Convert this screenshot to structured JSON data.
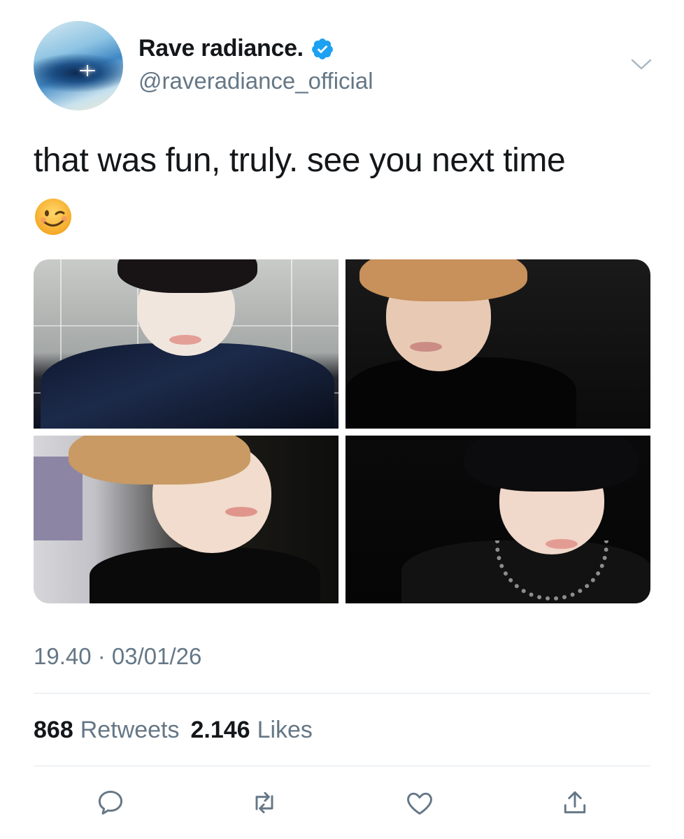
{
  "tweet": {
    "author": {
      "display_name": "Rave radiance.",
      "handle": "@raveradiance_official",
      "verified": true,
      "verified_color": "#1da1f2"
    },
    "text": "that was fun, truly. see you next time",
    "emoji": "winking-face",
    "media": [
      {
        "name": "photo-1"
      },
      {
        "name": "photo-2"
      },
      {
        "name": "photo-3"
      },
      {
        "name": "photo-4"
      }
    ],
    "timestamp": "19.40 · 03/01/26",
    "stats": {
      "retweets_count": "868",
      "retweets_label": "Retweets",
      "likes_count": "2.146",
      "likes_label": "Likes"
    },
    "actions": [
      "reply-icon",
      "retweet-icon",
      "like-icon",
      "share-icon"
    ]
  },
  "colors": {
    "text_primary": "#14171a",
    "text_secondary": "#657786",
    "divider": "#e1e8ed",
    "icon": "#657786"
  }
}
